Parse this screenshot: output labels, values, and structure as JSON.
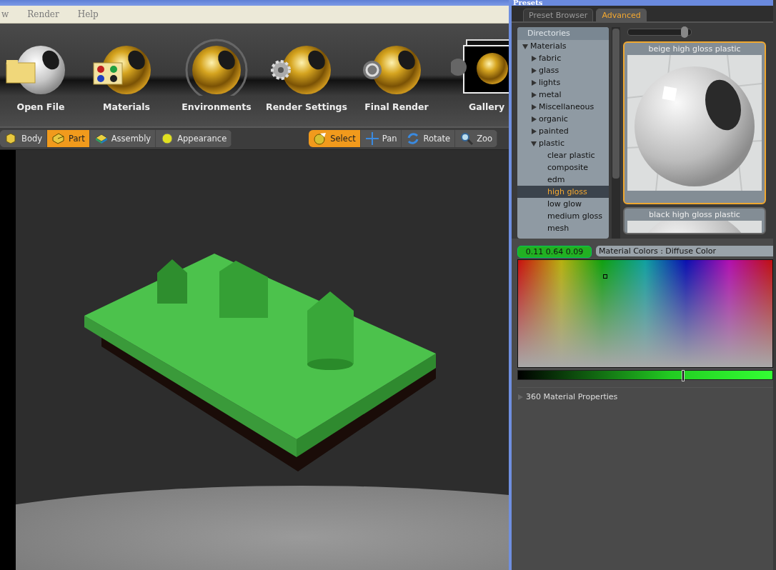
{
  "window": {
    "menu": [
      "w",
      "Render",
      "Help"
    ]
  },
  "main_toolbar": [
    {
      "label": "Open File",
      "kind": "file"
    },
    {
      "label": "Materials",
      "kind": "materials"
    },
    {
      "label": "Environments",
      "kind": "environment"
    },
    {
      "label": "Render Settings",
      "kind": "settings"
    },
    {
      "label": "Final Render",
      "kind": "render"
    },
    {
      "label": "Gallery",
      "kind": "gallery"
    }
  ],
  "mode_buttons": [
    {
      "label": "Body",
      "kind": "body",
      "selected": false
    },
    {
      "label": "Part",
      "kind": "part",
      "selected": true
    },
    {
      "label": "Assembly",
      "kind": "assembly",
      "selected": false
    },
    {
      "label": "Appearance",
      "kind": "appearance",
      "selected": false
    }
  ],
  "tool_buttons": [
    {
      "label": "Select",
      "kind": "select",
      "selected": true
    },
    {
      "label": "Pan",
      "kind": "pan",
      "selected": false
    },
    {
      "label": "Rotate",
      "kind": "rotate",
      "selected": false
    },
    {
      "label": "Zoo",
      "kind": "zoom",
      "selected": false
    }
  ],
  "presets": {
    "title": "Presets",
    "tabs": [
      {
        "label": "Preset Browser",
        "selected": false
      },
      {
        "label": "Advanced",
        "selected": true
      }
    ],
    "directories_header": "Directories",
    "tree": [
      {
        "label": "Materials",
        "expanded": true,
        "selected": false,
        "children": [
          {
            "label": "fabric",
            "expanded": false,
            "selected": false
          },
          {
            "label": "glass",
            "expanded": false,
            "selected": false
          },
          {
            "label": "lights",
            "expanded": false,
            "selected": false
          },
          {
            "label": "metal",
            "expanded": false,
            "selected": false
          },
          {
            "label": "Miscellaneous",
            "expanded": false,
            "selected": false
          },
          {
            "label": "organic",
            "expanded": false,
            "selected": false
          },
          {
            "label": "painted",
            "expanded": false,
            "selected": false
          },
          {
            "label": "plastic",
            "expanded": true,
            "selected": false,
            "children": [
              {
                "label": "clear plastic",
                "selected": false
              },
              {
                "label": "composite",
                "selected": false
              },
              {
                "label": "edm",
                "selected": false
              },
              {
                "label": "high gloss",
                "selected": true
              },
              {
                "label": "low glow",
                "selected": false
              },
              {
                "label": "medium gloss",
                "selected": false
              },
              {
                "label": "mesh",
                "selected": false
              }
            ]
          }
        ]
      }
    ],
    "size_slider": {
      "level": 0.9
    },
    "thumbnails": [
      {
        "label": "beige high gloss plastic",
        "selected": true
      },
      {
        "label": "black high gloss plastic",
        "selected": false
      }
    ],
    "color_value": "0.11 0.64 0.09",
    "color_title": "Material Colors : Diffuse Color",
    "brightness": {
      "level": 0.65
    },
    "section": {
      "label": "360 Material Properties",
      "expanded": false
    }
  }
}
